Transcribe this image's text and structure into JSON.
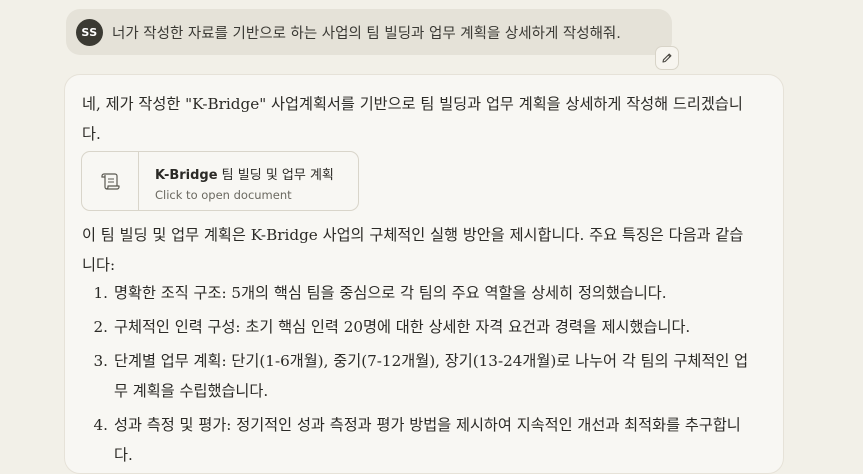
{
  "user_message": {
    "avatar_initials": "SS",
    "text": "너가 작성한 자료를 기반으로 하는 사업의 팀 빌딩과 업무 계획을 상세하게 작성해줘."
  },
  "edit_button": {
    "icon": "pencil-icon"
  },
  "assistant_message": {
    "intro": "네, 제가 작성한 \"K-Bridge\" 사업계획서를 기반으로 팀 빌딩과 업무 계획을 상세하게 작성해 드리겠습니다.",
    "document_card": {
      "icon": "scroll-icon",
      "title_bold": "K-Bridge",
      "title_rest": " 팀 빌딩 및 업무 계획",
      "subtitle": "Click to open document"
    },
    "summary": "이 팀 빌딩 및 업무 계획은 K-Bridge 사업의 구체적인 실행 방안을 제시합니다. 주요 특징은 다음과 같습니다:",
    "list": [
      {
        "num": "1.",
        "text": "명확한 조직 구조: 5개의 핵심 팀을 중심으로 각 팀의 주요 역할을 상세히 정의했습니다."
      },
      {
        "num": "2.",
        "text": "구체적인 인력 구성: 초기 핵심 인력 20명에 대한 상세한 자격 요건과 경력을 제시했습니다."
      },
      {
        "num": "3.",
        "text": "단계별 업무 계획: 단기(1-6개월), 중기(7-12개월), 장기(13-24개월)로 나누어 각 팀의 구체적인 업무 계획을 수립했습니다."
      },
      {
        "num": "4.",
        "text": "성과 측정 및 평가: 정기적인 성과 측정과 평가 방법을 제시하여 지속적인 개선과 최적화를 추구합니다."
      }
    ]
  }
}
